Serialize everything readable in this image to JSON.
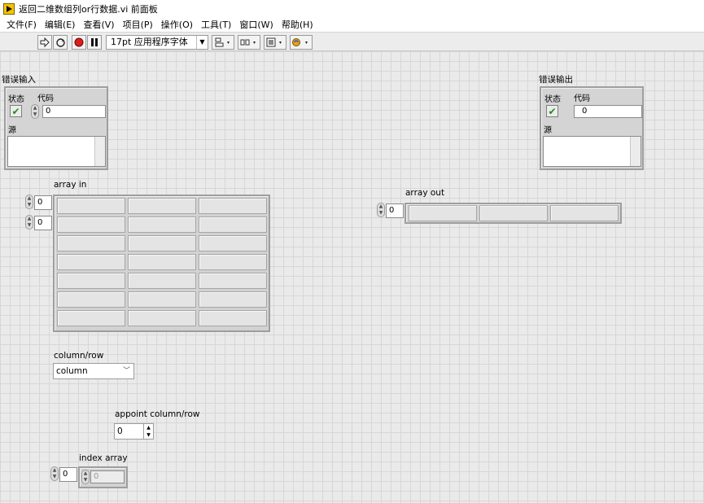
{
  "window": {
    "title": "返回二维数组列or行数据.vi 前面板"
  },
  "menu": [
    "文件(F)",
    "编辑(E)",
    "查看(V)",
    "项目(P)",
    "操作(O)",
    "工具(T)",
    "窗口(W)",
    "帮助(H)"
  ],
  "toolbar": {
    "font_size_select": "17pt 应用程序字体"
  },
  "error_in": {
    "label": "错误输入",
    "status_label": "状态",
    "code_label": "代码",
    "code_value": "0",
    "source_label": "源"
  },
  "error_out": {
    "label": "错误输出",
    "status_label": "状态",
    "code_label": "代码",
    "code_value": "0",
    "source_label": "源"
  },
  "array_in": {
    "label": "array in",
    "row_index": "0",
    "col_index": "0"
  },
  "array_out": {
    "label": "array out",
    "index": "0"
  },
  "column_row": {
    "label": "column/row",
    "value": "column"
  },
  "appoint": {
    "label": "appoint column/row",
    "value": "0"
  },
  "index_array": {
    "label": "index array",
    "index": "0",
    "element": "0"
  }
}
